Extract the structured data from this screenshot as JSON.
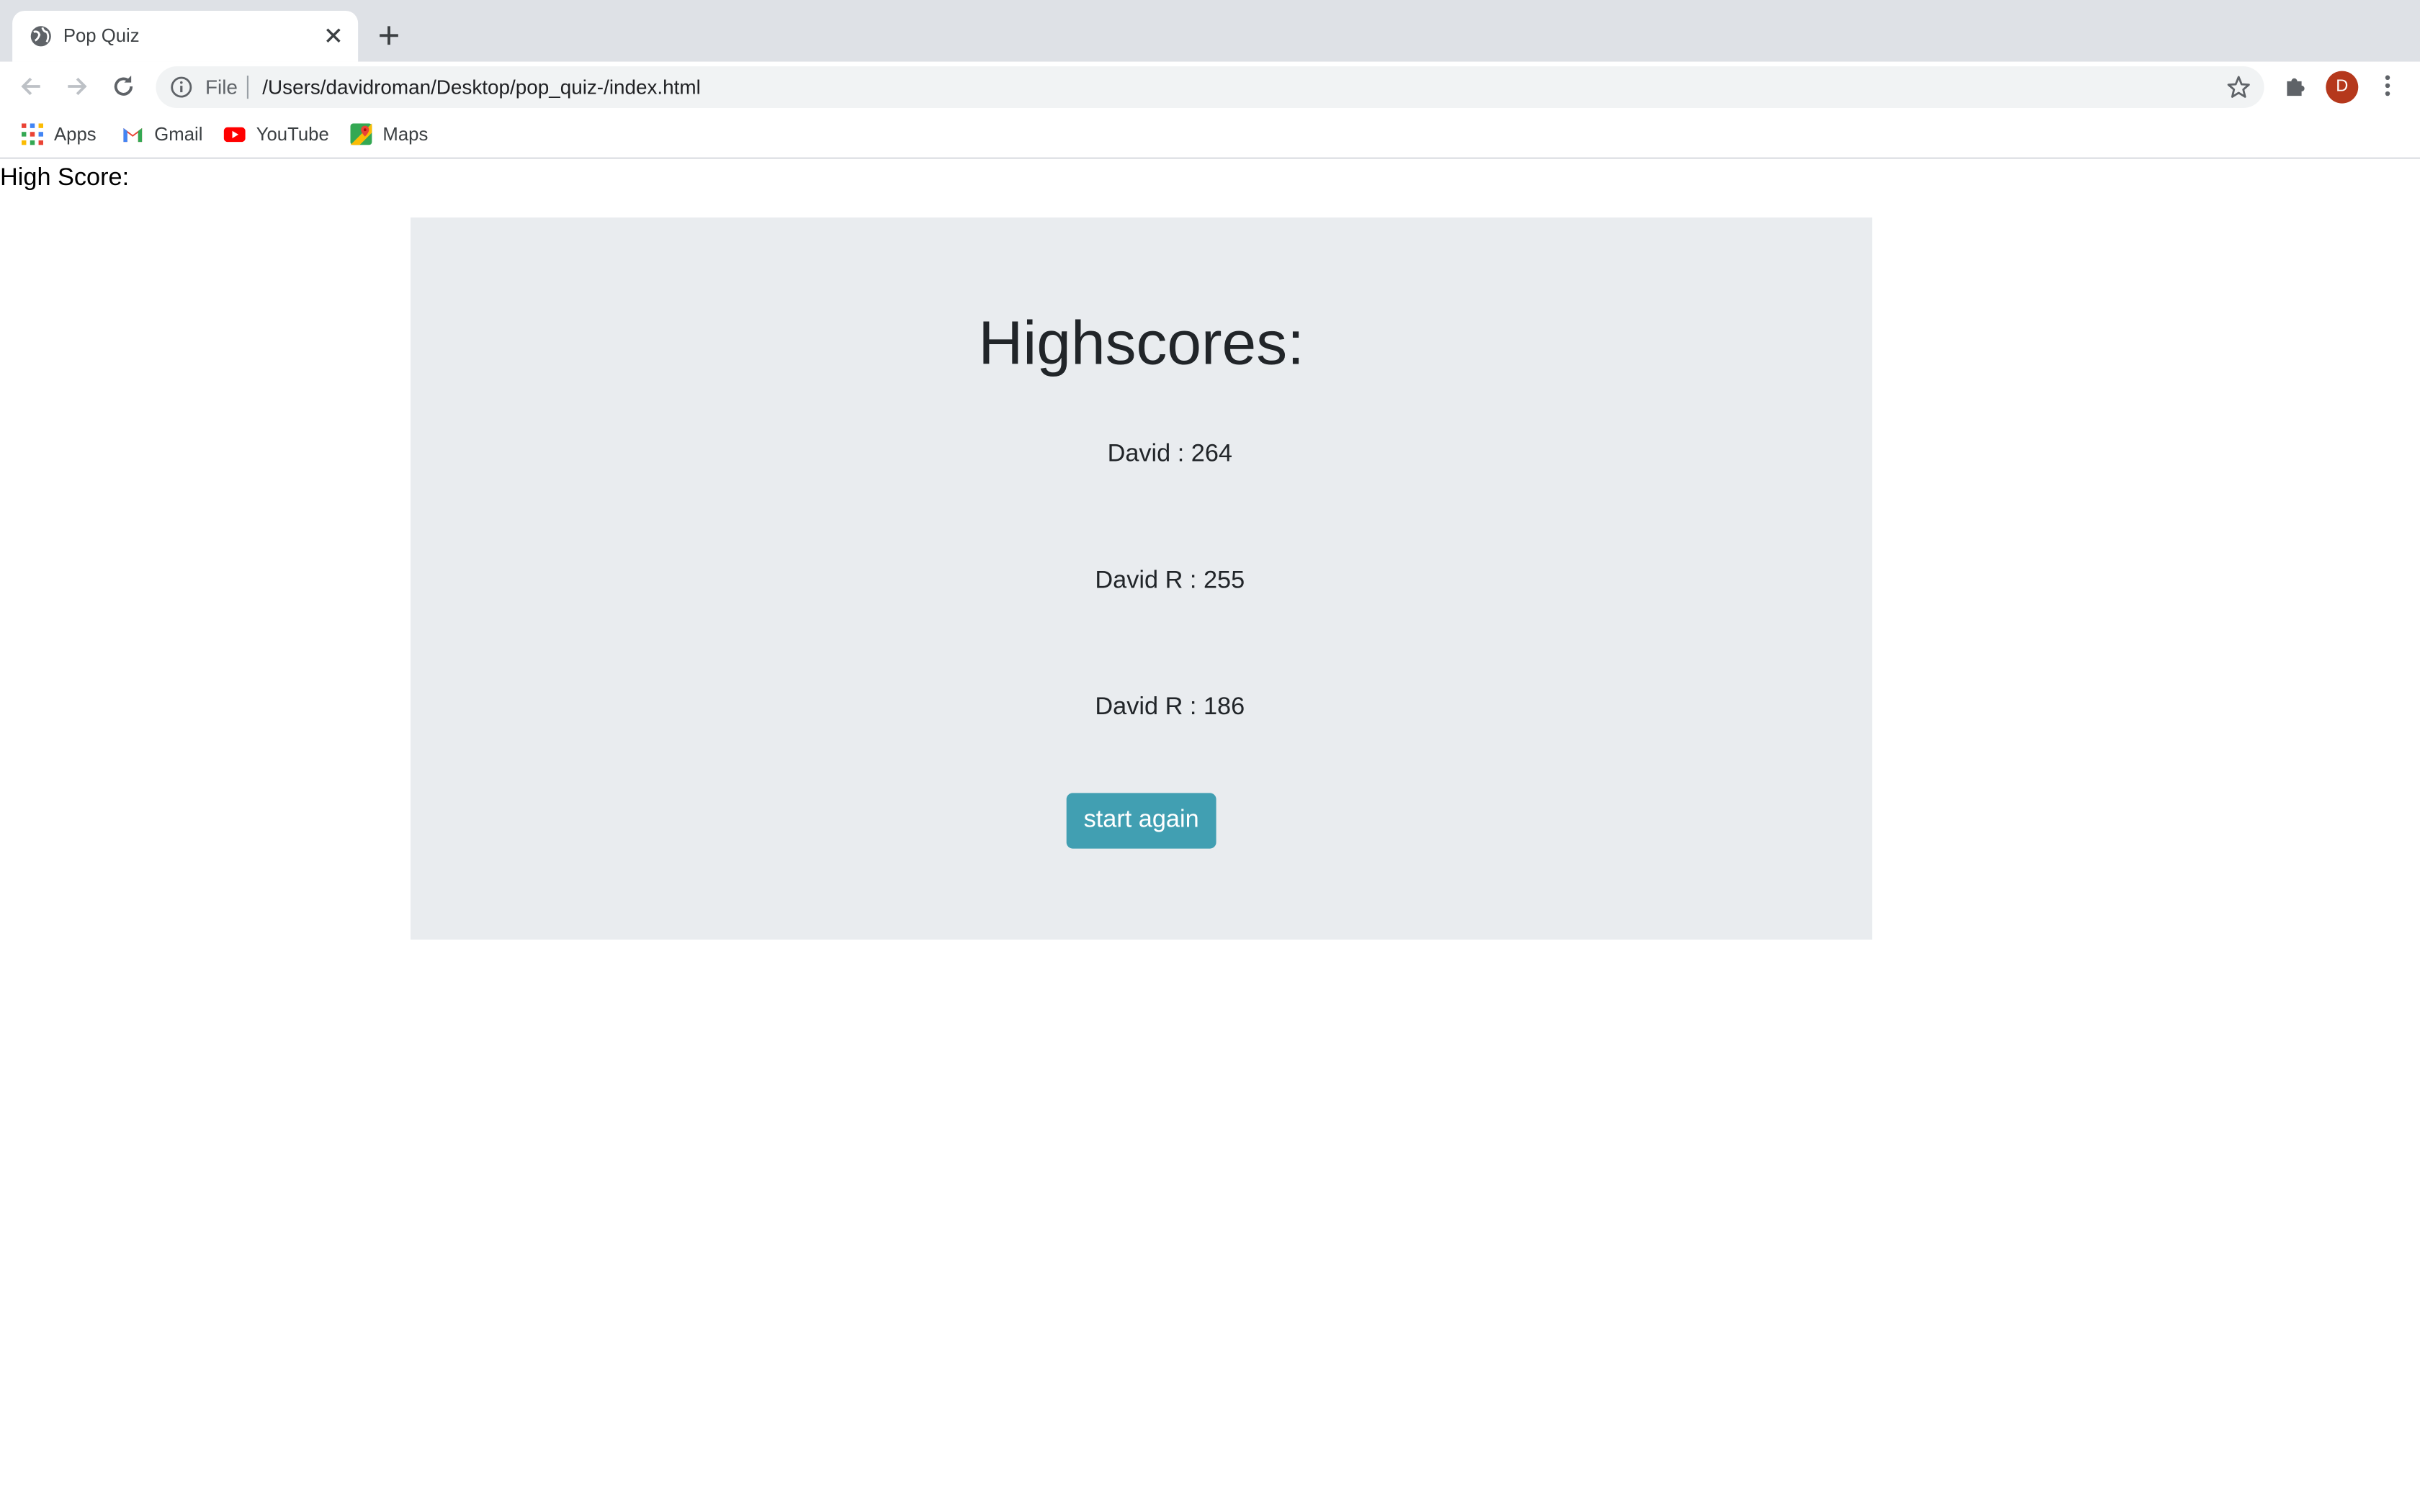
{
  "browser": {
    "tab": {
      "title": "Pop Quiz"
    },
    "address": {
      "scheme": "File",
      "url": "/Users/davidroman/Desktop/pop_quiz-/index.html"
    },
    "avatar_letter": "D",
    "bookmarks": [
      {
        "label": "Apps",
        "icon": "apps-grid-icon"
      },
      {
        "label": "Gmail",
        "icon": "gmail-icon"
      },
      {
        "label": "YouTube",
        "icon": "youtube-icon"
      },
      {
        "label": "Maps",
        "icon": "maps-icon"
      }
    ]
  },
  "page": {
    "high_score_label": "High Score:",
    "card_title": "Highscores:",
    "scores": [
      {
        "text": "David : 264"
      },
      {
        "text": "David R : 255"
      },
      {
        "text": "David R : 186"
      }
    ],
    "start_again_label": "start again"
  },
  "colors": {
    "card_background": "#e9ecef",
    "button_background": "#419fb2",
    "avatar_background": "#b5381c"
  }
}
